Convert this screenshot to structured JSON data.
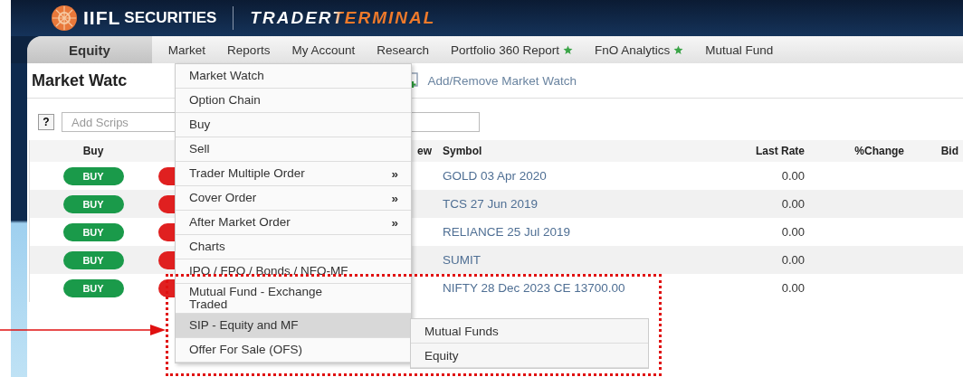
{
  "brand": {
    "name": "IIFL",
    "suffix": "SECURITIES",
    "product": "TRADERTERMINAL"
  },
  "nav": [
    {
      "label": "Equity",
      "selected": true,
      "starred": false
    },
    {
      "label": "Market",
      "selected": false,
      "starred": false
    },
    {
      "label": "Reports",
      "selected": false,
      "starred": false
    },
    {
      "label": "My Account",
      "selected": false,
      "starred": false
    },
    {
      "label": "Research",
      "selected": false,
      "starred": false
    },
    {
      "label": "Portfolio 360 Report",
      "selected": false,
      "starred": true
    },
    {
      "label": "FnO Analytics",
      "selected": false,
      "starred": true
    },
    {
      "label": "Mutual Fund",
      "selected": false,
      "starred": false
    }
  ],
  "page_title": "Market Watc",
  "add_remove_link": "Add/Remove Market Watch",
  "help_button": "?",
  "search": {
    "placeholder": "Add Scrips"
  },
  "table": {
    "columns": [
      "Buy",
      "ew",
      "Symbol",
      "Last Rate",
      "%Change",
      "Bid"
    ],
    "rows": [
      {
        "buy": "BUY",
        "symbol": "GOLD 03 Apr 2020",
        "last_rate": "0.00"
      },
      {
        "buy": "BUY",
        "symbol": "TCS 27 Jun 2019",
        "last_rate": "0.00"
      },
      {
        "buy": "BUY",
        "symbol": "RELIANCE 25 Jul 2019",
        "last_rate": "0.00"
      },
      {
        "buy": "BUY",
        "symbol": "SUMIT",
        "last_rate": "0.00"
      },
      {
        "buy": "BUY",
        "symbol": "NIFTY 28 Dec 2023 CE 13700.00",
        "last_rate": "0.00"
      }
    ]
  },
  "menu": {
    "items": [
      {
        "label": "Market Watch",
        "selected": false
      },
      {
        "label": "Option Chain",
        "selected": false
      },
      {
        "label": "Buy",
        "selected": false
      },
      {
        "label": "Sell",
        "selected": false
      },
      {
        "label": "Trader Multiple Order",
        "selected": false,
        "arrow": "»"
      },
      {
        "label": "Cover Order",
        "selected": false,
        "arrow": "»"
      },
      {
        "label": "After Market Order",
        "selected": false,
        "arrow": "»"
      },
      {
        "label": "Charts",
        "selected": false
      },
      {
        "label": "IPO / FPO / Bonds / NFO-MF",
        "selected": false
      },
      {
        "label": "Mutual Fund - Exchange Traded",
        "selected": false
      },
      {
        "label": "SIP - Equity and MF",
        "selected": true
      },
      {
        "label": "Offer For Sale (OFS)",
        "selected": false
      }
    ],
    "submenu": [
      "Mutual Funds",
      "Equity"
    ]
  }
}
